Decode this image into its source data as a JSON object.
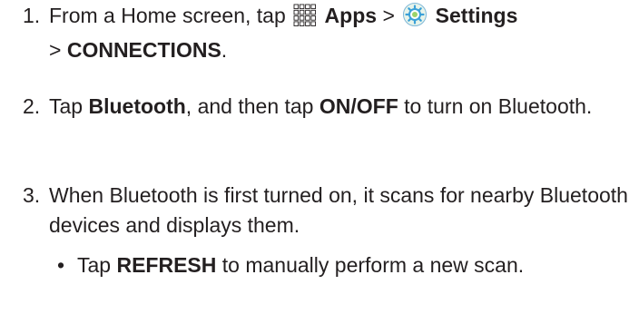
{
  "steps": [
    {
      "number": "1.",
      "parts": {
        "t1": "From a Home screen, tap",
        "apps_icon": "apps-grid-icon",
        "apps": "Apps",
        "sep1": ">",
        "settings_icon": "settings-gear-icon",
        "settings": "Settings",
        "sep2": ">",
        "connections": "CONNECTIONS",
        "end": "."
      }
    },
    {
      "number": "2.",
      "parts": {
        "t1": "Tap",
        "bluetooth": "Bluetooth",
        "t2": ", and then tap",
        "onoff": "ON/OFF",
        "t3": "to turn on Bluetooth."
      }
    },
    {
      "number": "3.",
      "text": "When Bluetooth is first turned on, it scans for nearby Bluetooth devices and displays them."
    }
  ],
  "bullet": {
    "marker": "•",
    "t1": "Tap",
    "refresh": "REFRESH",
    "t2": "to manually perform a new scan."
  },
  "colors": {
    "text": "#231f20",
    "settings_icon_blue": "#3aa0d8",
    "settings_icon_green": "#9bd36a"
  }
}
